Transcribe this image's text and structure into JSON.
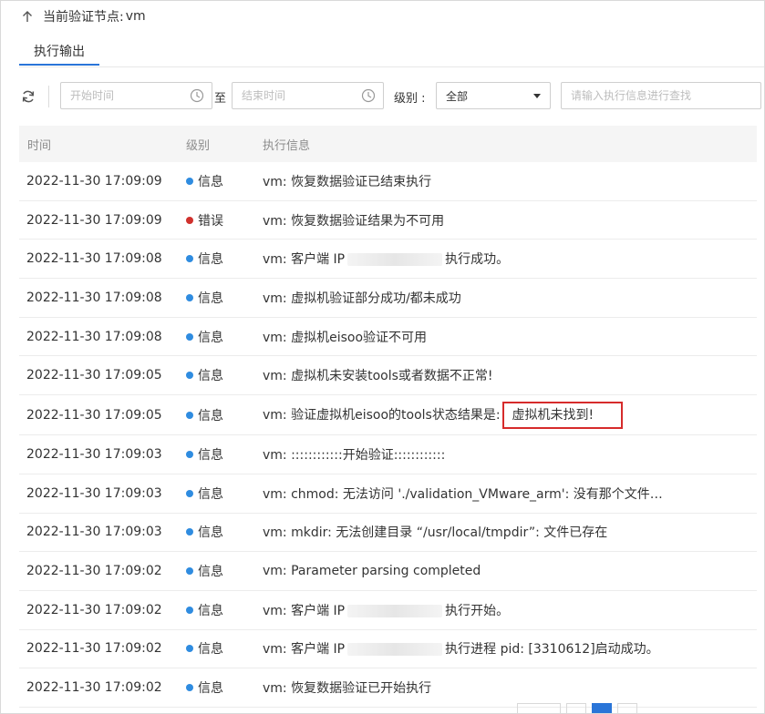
{
  "header": {
    "node_label": "当前验证节点:",
    "node_name": "vm"
  },
  "tabs": [
    {
      "label": "执行输出",
      "active": true
    }
  ],
  "toolbar": {
    "start_time_placeholder": "开始时间",
    "to_label": "至",
    "end_time_placeholder": "结束时间",
    "level_label": "级别 :",
    "level_value": "全部",
    "search_placeholder": "请输入执行信息进行查找"
  },
  "table": {
    "columns": [
      "时间",
      "级别",
      "执行信息"
    ],
    "rows": [
      {
        "time": "2022-11-30 17:09:09",
        "level": "信息",
        "level_type": "info",
        "prefix": "vm: 恢复数据验证已结束执行"
      },
      {
        "time": "2022-11-30 17:09:09",
        "level": "错误",
        "level_type": "error",
        "prefix": "vm:  恢复数据验证结果为不可用"
      },
      {
        "time": "2022-11-30 17:09:08",
        "level": "信息",
        "level_type": "info",
        "prefix": "vm: 客户端 IP",
        "masked": true,
        "suffix": "执行成功。"
      },
      {
        "time": "2022-11-30 17:09:08",
        "level": "信息",
        "level_type": "info",
        "prefix": "vm: 虚拟机验证部分成功/都未成功"
      },
      {
        "time": "2022-11-30 17:09:08",
        "level": "信息",
        "level_type": "info",
        "prefix": "vm: 虚拟机eisoo验证不可用"
      },
      {
        "time": "2022-11-30 17:09:05",
        "level": "信息",
        "level_type": "info",
        "prefix": "vm: 虚拟机未安装tools或者数据不正常!"
      },
      {
        "time": "2022-11-30 17:09:05",
        "level": "信息",
        "level_type": "info",
        "prefix": "vm: 验证虚拟机eisoo的tools状态结果是:",
        "highlight": "虚拟机未找到!"
      },
      {
        "time": "2022-11-30 17:09:03",
        "level": "信息",
        "level_type": "info",
        "prefix": "vm: ::::::::::::开始验证::::::::::::"
      },
      {
        "time": "2022-11-30 17:09:03",
        "level": "信息",
        "level_type": "info",
        "prefix": "vm: chmod: 无法访问 './validation_VMware_arm': 没有那个文件…"
      },
      {
        "time": "2022-11-30 17:09:03",
        "level": "信息",
        "level_type": "info",
        "prefix": "vm: mkdir: 无法创建目录 “/usr/local/tmpdir”: 文件已存在"
      },
      {
        "time": "2022-11-30 17:09:02",
        "level": "信息",
        "level_type": "info",
        "prefix": "vm: Parameter parsing completed"
      },
      {
        "time": "2022-11-30 17:09:02",
        "level": "信息",
        "level_type": "info",
        "prefix": "vm: 客户端 IP",
        "masked": true,
        "suffix": "执行开始。"
      },
      {
        "time": "2022-11-30 17:09:02",
        "level": "信息",
        "level_type": "info",
        "prefix": "vm: 客户端 IP",
        "masked": true,
        "suffix": "执行进程 pid: [3310612]启动成功。"
      },
      {
        "time": "2022-11-30 17:09:02",
        "level": "信息",
        "level_type": "info",
        "prefix": "vm: 恢复数据验证已开始执行"
      }
    ]
  },
  "colors": {
    "accent": "#2a75d8",
    "info_dot": "#2f8ce0",
    "error_dot": "#d0312d",
    "highlight_border": "#d62b2b"
  }
}
